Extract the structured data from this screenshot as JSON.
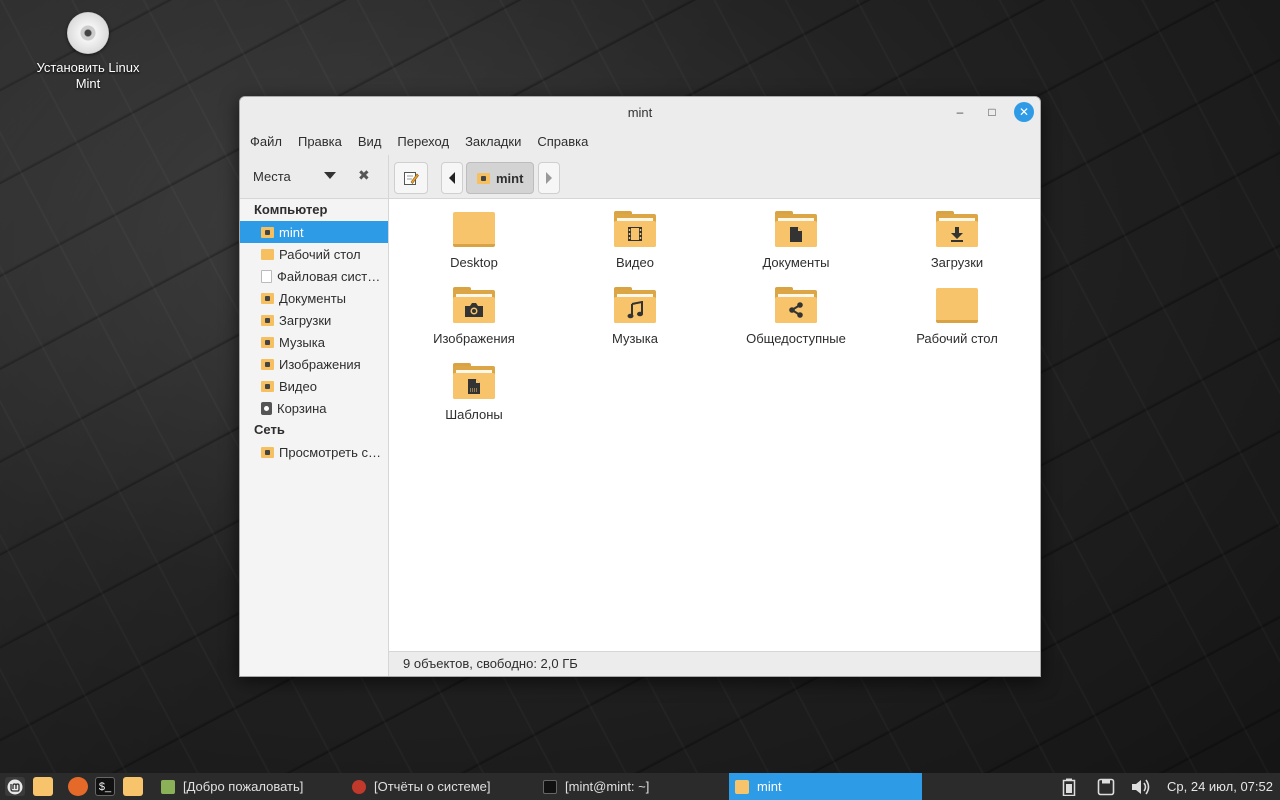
{
  "desktop": {
    "icon_label": "Установить Linux Mint"
  },
  "window": {
    "title": "mint",
    "controls": {
      "minimize": "–",
      "maximize": "□",
      "close": "✕"
    },
    "menu": [
      "Файл",
      "Правка",
      "Вид",
      "Переход",
      "Закладки",
      "Справка"
    ],
    "toolbar": {
      "places_label": "Места",
      "breadcrumb": "mint"
    },
    "sidebar": {
      "computer_header": "Компьютер",
      "computer_items": [
        "mint",
        "Рабочий стол",
        "Файловая сист…",
        "Документы",
        "Загрузки",
        "Музыка",
        "Изображения",
        "Видео",
        "Корзина"
      ],
      "network_header": "Сеть",
      "network_items": [
        "Просмотреть с…"
      ]
    },
    "content": {
      "items": [
        {
          "label": "Desktop",
          "icon": "folder-icon"
        },
        {
          "label": "Видео",
          "icon": "video-folder-icon"
        },
        {
          "label": "Документы",
          "icon": "documents-folder-icon"
        },
        {
          "label": "Загрузки",
          "icon": "downloads-folder-icon"
        },
        {
          "label": "Изображения",
          "icon": "pictures-folder-icon"
        },
        {
          "label": "Музыка",
          "icon": "music-folder-icon"
        },
        {
          "label": "Общедоступные",
          "icon": "public-share-folder-icon"
        },
        {
          "label": "Рабочий стол",
          "icon": "desktop-folder-icon"
        },
        {
          "label": "Шаблоны",
          "icon": "templates-folder-icon"
        }
      ]
    },
    "status": "9 объектов, свободно: 2,0 ГБ"
  },
  "taskbar": {
    "tasks": [
      "[Добро пожаловать]",
      "[Отчёты о системе]",
      "[mint@mint: ~]",
      "mint"
    ],
    "clock": "Ср, 24 июл, 07:52"
  },
  "colors": {
    "accent": "#2e9be6",
    "folder": "#f7c46b",
    "folder_dark": "#dca546",
    "taskbar": "#2b2b2b"
  }
}
